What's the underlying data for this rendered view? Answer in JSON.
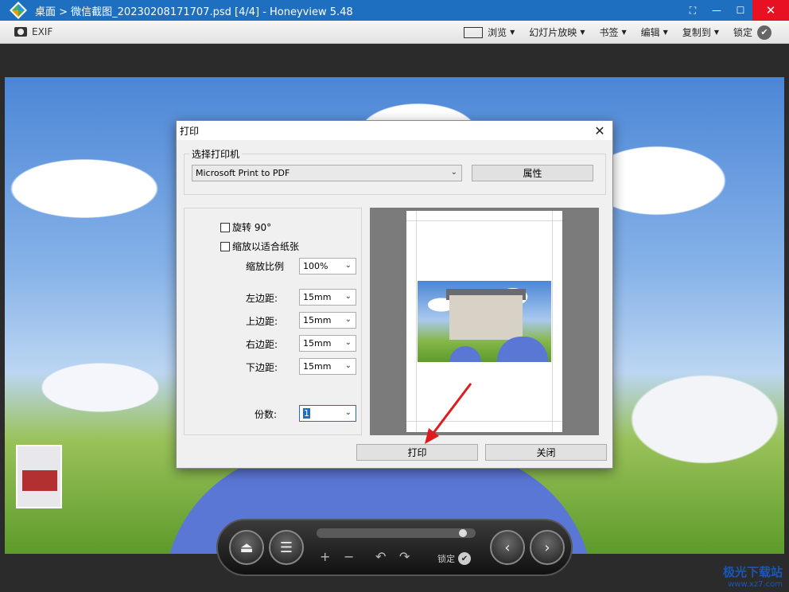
{
  "window": {
    "title": "桌面 > 微信截图_20230208171707.psd [4/4] - Honeyview 5.48",
    "close_glyph": "✕",
    "maximize_glyph": "☐",
    "minimize_glyph": "—",
    "fullscreen_glyph": "⛶"
  },
  "toolbar": {
    "exif_label": "EXIF",
    "items": [
      {
        "label": "浏览"
      },
      {
        "label": "幻灯片放映"
      },
      {
        "label": "书签"
      },
      {
        "label": "编辑"
      },
      {
        "label": "复制到"
      },
      {
        "label": "锁定"
      }
    ]
  },
  "dialog": {
    "title": "打印",
    "printer_group_label": "选择打印机",
    "printer_selected": "Microsoft Print to PDF",
    "properties_button": "属性",
    "rotate_label": "旋转 90°",
    "rotate_checked": false,
    "fit_label": "缩放以适合纸张",
    "fit_checked": false,
    "scale_label": "缩放比例",
    "scale_value": "100%",
    "left_margin_label": "左边距:",
    "left_margin_value": "15mm",
    "top_margin_label": "上边距:",
    "top_margin_value": "15mm",
    "right_margin_label": "右边距:",
    "right_margin_value": "15mm",
    "bottom_margin_label": "下边距:",
    "bottom_margin_value": "15mm",
    "copies_label": "份数:",
    "copies_value": "1",
    "print_button": "打印",
    "close_button": "关闭"
  },
  "controls": {
    "lock_label": "锁定",
    "slider_position": 0.95
  },
  "watermark": {
    "text": "极光下载站",
    "url": "www.xz7.com"
  },
  "colors": {
    "titlebar": "#1e6fc0",
    "close": "#e81123",
    "annotation_arrow": "#e01b1b"
  }
}
